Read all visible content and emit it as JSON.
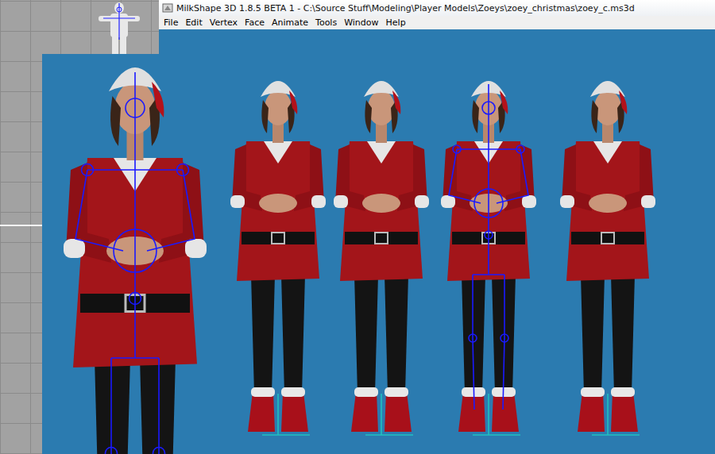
{
  "window": {
    "title": "MilkShape 3D 1.8.5 BETA 1 - C:\\Source Stuff\\Modeling\\Player Models\\Zoeys\\zoey_christmas\\zoey_c.ms3d"
  },
  "menu": [
    "File",
    "Edit",
    "Vertex",
    "Face",
    "Animate",
    "Tools",
    "Window",
    "Help"
  ],
  "viewports": [
    {
      "skeleton": true
    },
    {
      "skeleton": false
    },
    {
      "skeleton": false
    },
    {
      "skeleton": true
    },
    {
      "skeleton": false
    }
  ]
}
